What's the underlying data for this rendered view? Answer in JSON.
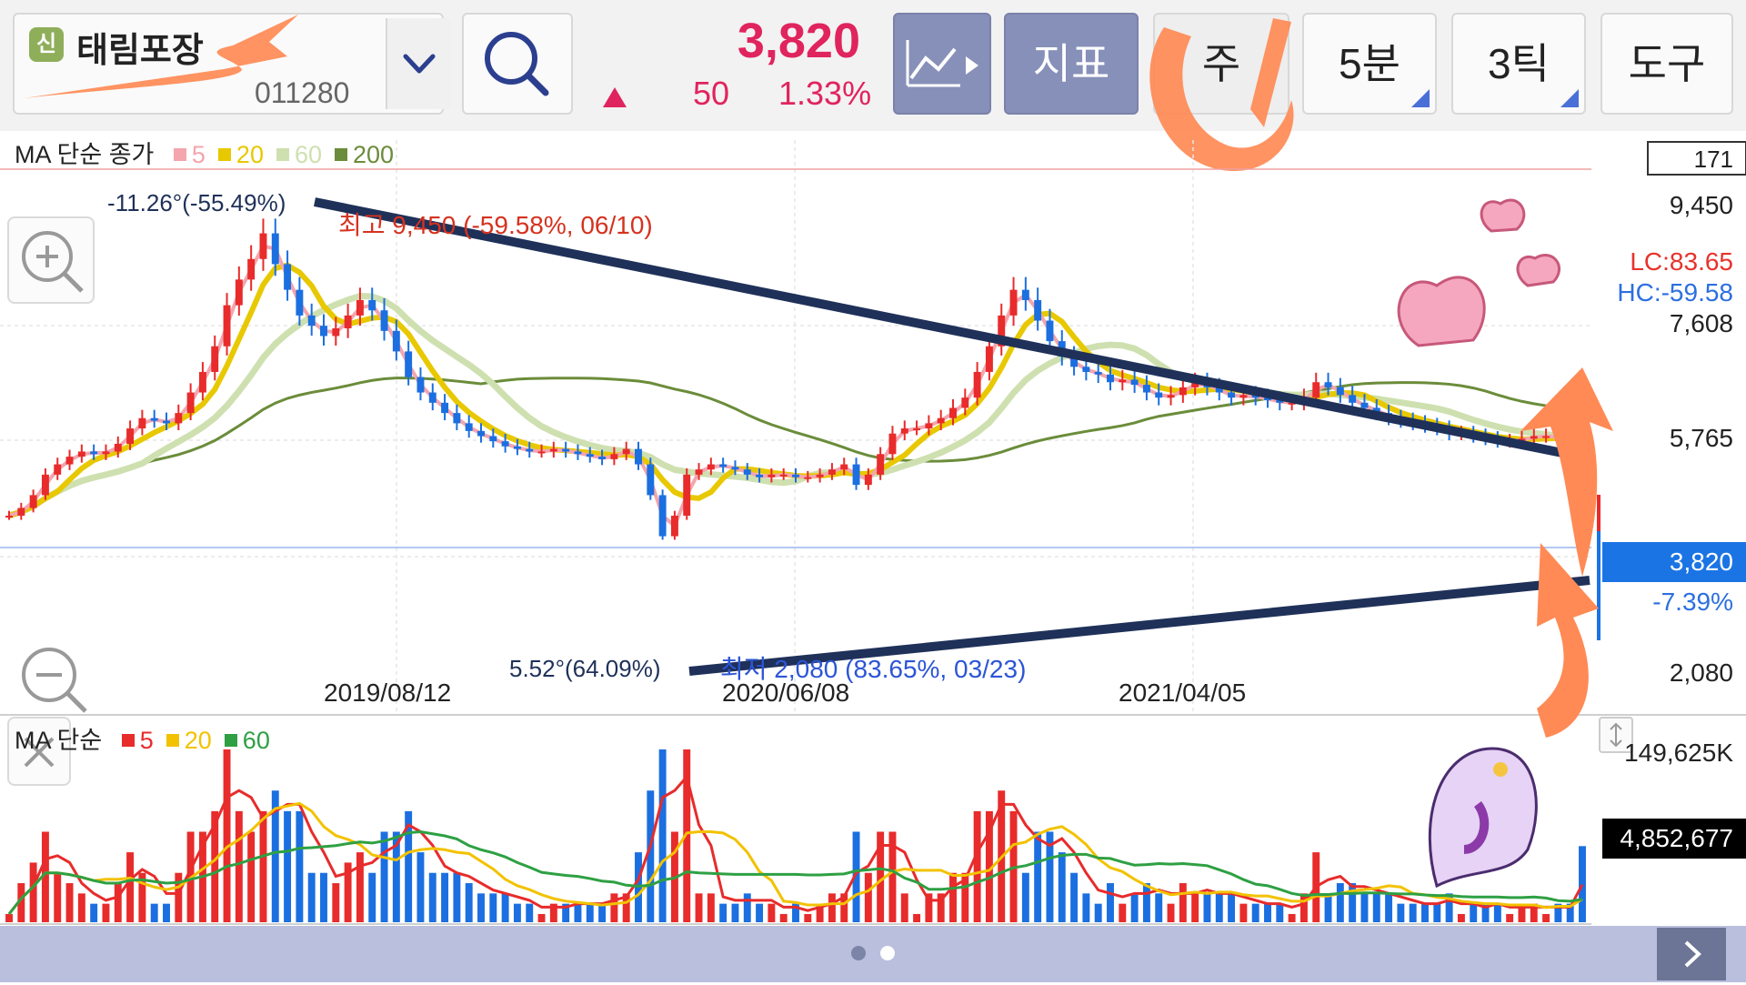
{
  "header": {
    "badge": "신",
    "stock_name": "태림포장",
    "stock_code": "011280",
    "price": "3,820",
    "change": "50",
    "change_pct": "1.33%",
    "buttons": {
      "indicator": "지표",
      "period": "주",
      "interval": "5분",
      "tick": "3틱",
      "tools": "도구"
    },
    "icons": [
      "dropdown-chevron-icon",
      "search-icon",
      "chart-type-icon"
    ]
  },
  "chart_data": [
    {
      "type": "candlestick",
      "title": "",
      "legend": {
        "label": "MA 단순 종가",
        "items": [
          {
            "name": "5",
            "color": "#f4a5ae"
          },
          {
            "name": "20",
            "color": "#e8c800"
          },
          {
            "name": "60",
            "color": "#cfe0b0"
          },
          {
            "name": "200",
            "color": "#6b8c3a"
          }
        ]
      },
      "ylim": [
        2080,
        9450
      ],
      "y_ticks": [
        "9,450",
        "7,608",
        "5,765",
        "3,820",
        "2,080"
      ],
      "x_ticks": [
        "2019/08/12",
        "2020/06/08",
        "2021/04/05"
      ],
      "top_box": "171",
      "current_price": "3,820",
      "current_pct": "-7.39%",
      "LC": "LC:83.65",
      "HC": "HC:-59.58",
      "annotations": {
        "high_label": "최고 9,450 (-59.58%, 06/10)",
        "low_label": "최저 2,080 (83.65%, 03/23)",
        "upper_trend": "-11.26°(-55.49%)",
        "lower_trend": "5.52°(64.09%)"
      },
      "closes": [
        2700,
        2850,
        3100,
        3500,
        3700,
        3850,
        3950,
        3900,
        3950,
        4100,
        4400,
        4600,
        4550,
        4500,
        4700,
        5100,
        5500,
        6000,
        6800,
        7300,
        7700,
        8200,
        7600,
        7100,
        6600,
        6400,
        6200,
        6350,
        6600,
        6900,
        6700,
        6300,
        5900,
        5400,
        5100,
        4900,
        4700,
        4500,
        4350,
        4250,
        4150,
        4050,
        4000,
        3950,
        3950,
        4000,
        3950,
        3900,
        3850,
        3800,
        3900,
        4000,
        3700,
        3100,
        2300,
        2700,
        3500,
        3600,
        3700,
        3650,
        3600,
        3500,
        3450,
        3500,
        3500,
        3450,
        3450,
        3500,
        3600,
        3700,
        3300,
        3500,
        3900,
        4300,
        4400,
        4400,
        4500,
        4600,
        4800,
        5000,
        5500,
        6000,
        6600,
        7100,
        6900,
        6500,
        6100,
        5800,
        5600,
        5500,
        5450,
        5300,
        5350,
        5250,
        5100,
        5000,
        5050,
        5200,
        5300,
        5200,
        5100,
        5000,
        5050,
        5000,
        4950,
        4900,
        4900,
        5000,
        5300,
        5200,
        5050,
        4900,
        4800,
        4700,
        4600,
        4550,
        4500,
        4450,
        4400,
        4300,
        4300,
        4250,
        4200,
        4150,
        4150,
        4200,
        4250,
        4250,
        4200,
        4150,
        3820
      ]
    },
    {
      "type": "bar",
      "title": "",
      "legend": {
        "label": "MA 단순",
        "items": [
          {
            "name": "5",
            "color": "#e82b2b"
          },
          {
            "name": "20",
            "color": "#f2c200"
          },
          {
            "name": "60",
            "color": "#2ea043"
          }
        ]
      },
      "y_max_label": "149,625K",
      "current_volume": "4,852,677"
    }
  ],
  "footer": {
    "page_dots": 2,
    "active_dot": 1
  }
}
